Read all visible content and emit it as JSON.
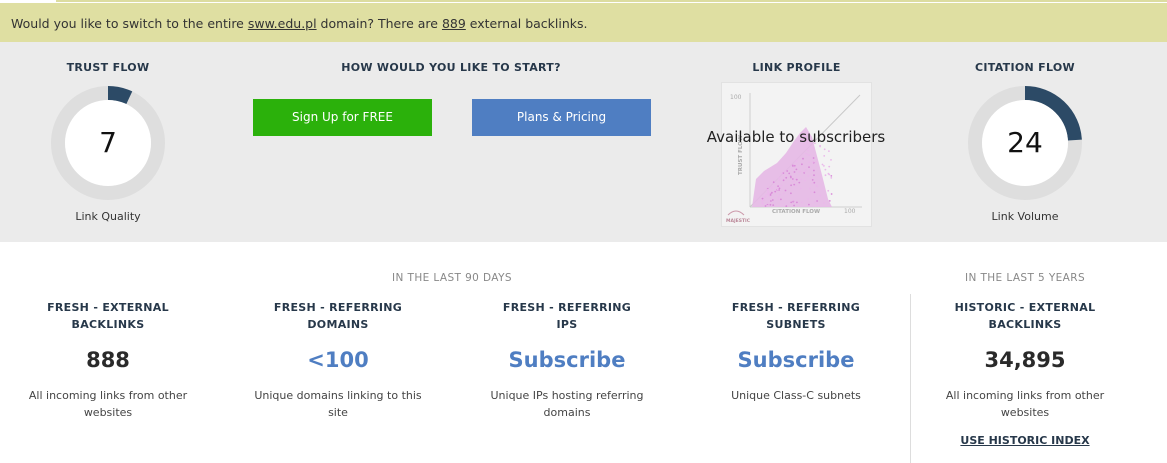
{
  "banner": {
    "prefix": "Would you like to switch to the entire ",
    "domain_link": "sww.edu.pl",
    "middle": " domain? There are ",
    "count_link": "889",
    "suffix": " external backlinks."
  },
  "trust_flow": {
    "title": "TRUST FLOW",
    "value": "7",
    "fraction": 0.07,
    "caption": "Link Quality"
  },
  "start": {
    "title": "HOW WOULD YOU LIKE TO START?",
    "signup_label": "Sign Up for FREE",
    "pricing_label": "Plans & Pricing"
  },
  "link_profile": {
    "title": "LINK PROFILE",
    "overlay": "Available to subscribers",
    "y_axis_label": "TRUST FLOW",
    "x_axis_label": "CITATION FLOW",
    "y_max_label": "100",
    "x_max_label": "100",
    "logo_text": "MAJESTIC"
  },
  "citation_flow": {
    "title": "CITATION FLOW",
    "value": "24",
    "fraction": 0.24,
    "caption": "Link Volume"
  },
  "periods": {
    "recent": "IN THE LAST 90 DAYS",
    "historic": "IN THE LAST 5 YEARS"
  },
  "metrics": [
    {
      "label_line1": "FRESH - EXTERNAL",
      "label_line2": "BACKLINKS",
      "value": "888",
      "desc_line1": "All incoming links from other",
      "desc_line2": "websites"
    },
    {
      "label_line1": "FRESH - REFERRING",
      "label_line2": "DOMAINS",
      "value": "<100",
      "desc_line1": "Unique domains linking to this",
      "desc_line2": "site"
    },
    {
      "label_line1": "FRESH - REFERRING",
      "label_line2": "IPS",
      "value": "Subscribe",
      "desc_line1": "Unique IPs hosting referring",
      "desc_line2": "domains"
    },
    {
      "label_line1": "FRESH - REFERRING",
      "label_line2": "SUBNETS",
      "value": "Subscribe",
      "desc_line1": "Unique Class-C subnets",
      "desc_line2": ""
    },
    {
      "label_line1": "HISTORIC - EXTERNAL",
      "label_line2": "BACKLINKS",
      "value": "34,895",
      "desc_line1": "All incoming links from other",
      "desc_line2": "websites"
    }
  ],
  "historic_link": "USE HISTORIC INDEX",
  "colors": {
    "banner": "#dfdfa2",
    "panel": "#ebebeb",
    "gauge_fill": "#2c4a66",
    "green": "#2bb10b",
    "blue": "#4f7ec2"
  }
}
